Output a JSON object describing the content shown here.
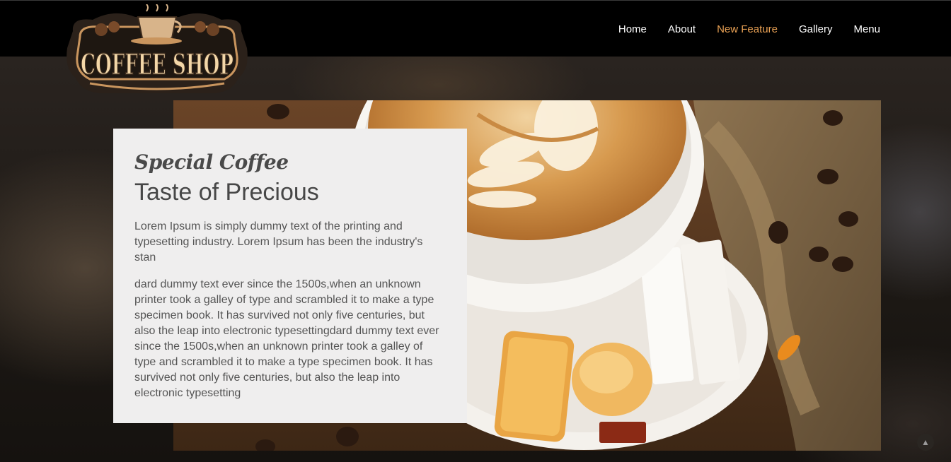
{
  "logo": {
    "text": "COFFEE SHOP"
  },
  "nav": {
    "items": [
      {
        "label": "Home"
      },
      {
        "label": "About"
      },
      {
        "label": "New Feature"
      },
      {
        "label": "Gallery"
      },
      {
        "label": "Menu"
      }
    ],
    "active_color": "#e9a154"
  },
  "hero": {
    "eyebrow": "Special Coffee",
    "title": "Taste of Precious",
    "paragraph1": "Lorem Ipsum is simply dummy text of the printing and typesetting industry. Lorem Ipsum has been the industry's stan",
    "paragraph2": "dard dummy text ever since the 1500s,when an unknown printer took a galley of type and scrambled it to make a type specimen book. It has survived not only five centuries, but also the leap into electronic typesettingdard dummy text ever since the 1500s,when an unknown printer took a galley of type and scrambled it to make a type specimen book. It has survived not only five centuries, but also the leap into electronic typesetting"
  },
  "scroll_top": {
    "icon": "chevron-up-icon",
    "glyph": "▲"
  }
}
